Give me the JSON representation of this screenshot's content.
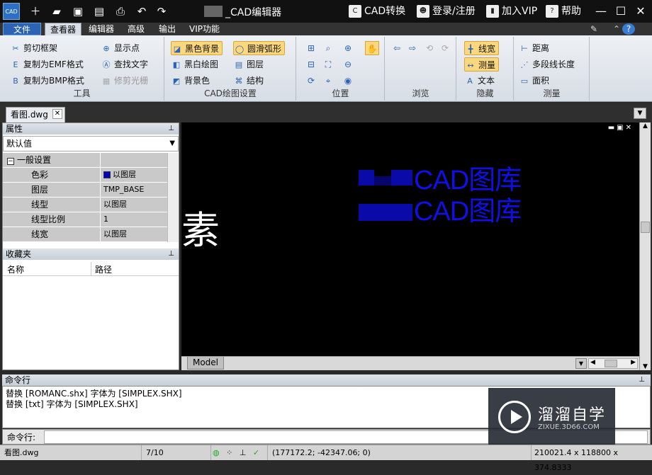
{
  "titlebar": {
    "title": "_CAD编辑器",
    "cad_convert": "CAD转换",
    "login": "登录/注册",
    "vip": "加入VIP",
    "help": "帮助"
  },
  "menu": {
    "file": "文件",
    "items": [
      "查看器",
      "编辑器",
      "高级",
      "输出",
      "VIP功能"
    ]
  },
  "ribbon": {
    "tools": {
      "label": "工具",
      "buttons": [
        "剪切框架",
        "复制为EMF格式",
        "复制为BMP格式",
        "显示点",
        "查找文字",
        "修剪光栅"
      ]
    },
    "cad_settings": {
      "label": "CAD绘图设置",
      "buttons": [
        "黑色背景",
        "黑白绘图",
        "背景色",
        "圆滑弧形",
        "图层",
        "结构"
      ]
    },
    "position": {
      "label": "位置"
    },
    "browse": {
      "label": "浏览"
    },
    "hide": {
      "label": "隐藏",
      "buttons": [
        "线宽",
        "测量",
        "文本"
      ]
    },
    "measure": {
      "label": "测量",
      "buttons": [
        "距离",
        "多段线长度",
        "面积"
      ]
    }
  },
  "doc_tab": {
    "name": "看图.dwg"
  },
  "properties": {
    "title": "属性",
    "select_value": "默认值",
    "section": "一般设置",
    "rows": [
      {
        "key": "色彩",
        "value": "以图层"
      },
      {
        "key": "图层",
        "value": "TMP_BASE"
      },
      {
        "key": "线型",
        "value": "以图层"
      },
      {
        "key": "线型比例",
        "value": "1"
      },
      {
        "key": "线宽",
        "value": "以图层"
      }
    ],
    "swatch_color": "#0000c0"
  },
  "favorites": {
    "title": "收藏夹",
    "col_name": "名称",
    "col_path": "路径"
  },
  "canvas": {
    "text_line1": "CAD图库",
    "text_line2": "CAD图库",
    "model_tab": "Model",
    "text_color": "#1010e6"
  },
  "command": {
    "title": "命令行",
    "lines": [
      "替换 [ROMANC.shx] 字体为 [SIMPLEX.SHX]",
      "替换 [txt] 字体为 [SIMPLEX.SHX]"
    ],
    "prompt": "命令行:"
  },
  "status": {
    "file": "看图.dwg",
    "page": "7/10",
    "coords": "(177172.2; -42347.06; 0)",
    "dimensions": "210021.4 x 118800 x 374.8333"
  },
  "watermark": {
    "brand": "溜溜自学",
    "url": "ZIXUE.3D66.COM"
  }
}
